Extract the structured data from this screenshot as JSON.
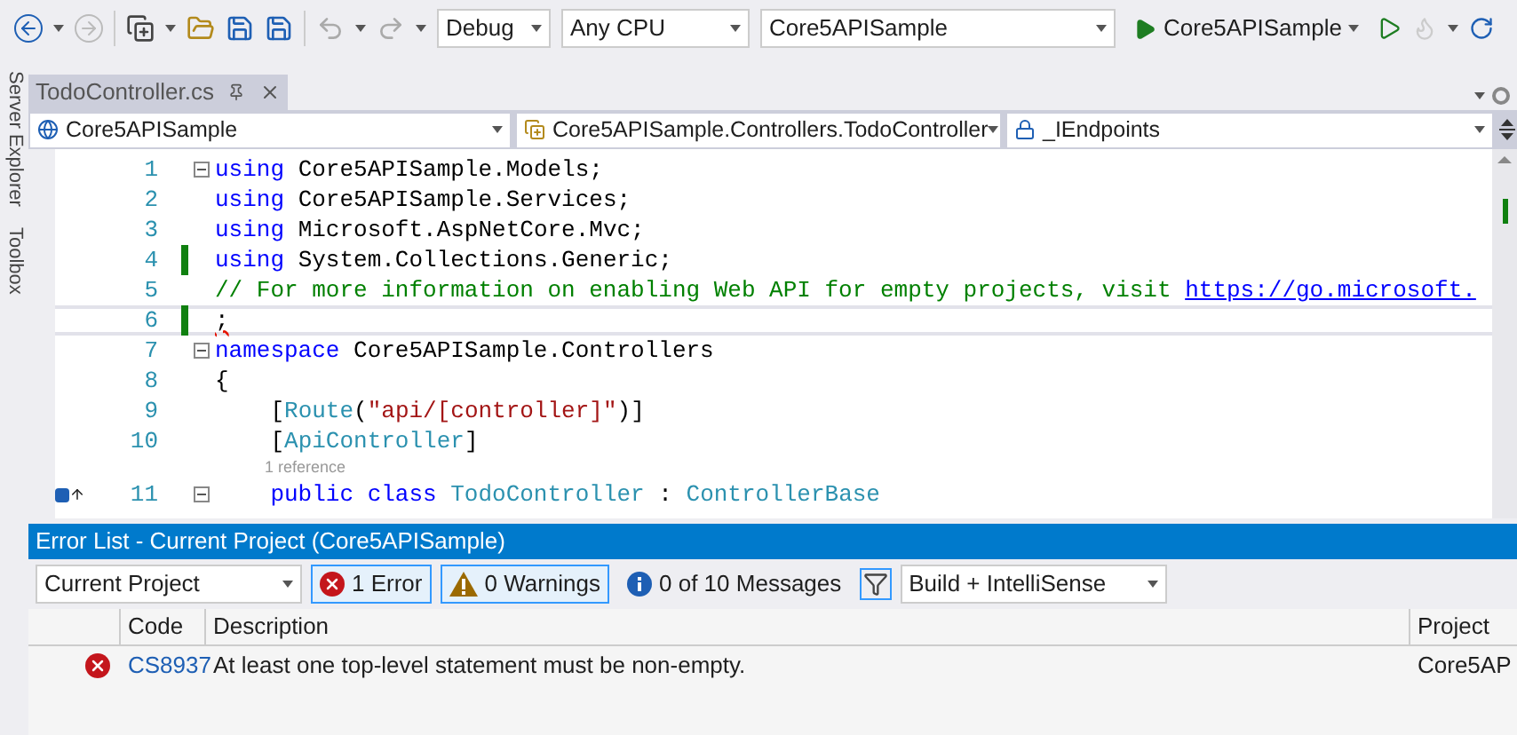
{
  "toolbar": {
    "configuration": "Debug",
    "platform": "Any CPU",
    "startup_project": "Core5APISample",
    "run_label": "Core5APISample"
  },
  "side_tabs": [
    "Server Explorer",
    "Toolbox"
  ],
  "document_tabs": [
    {
      "title": "TodoController.cs",
      "selected": true
    }
  ],
  "nav_bar": [
    "Core5APISample",
    "Core5APISample.Controllers.TodoController",
    "_IEndpoints"
  ],
  "editor": {
    "lines": [
      {
        "number": "1",
        "fold": true,
        "changed": false,
        "current": false,
        "tokens": [
          {
            "kind": "keyword",
            "text": "using"
          },
          {
            "kind": "plain",
            "text": " Core5APISample.Models;"
          }
        ]
      },
      {
        "number": "2",
        "fold": false,
        "changed": false,
        "current": false,
        "tokens": [
          {
            "kind": "keyword",
            "text": "using"
          },
          {
            "kind": "plain",
            "text": " Core5APISample.Services;"
          }
        ]
      },
      {
        "number": "3",
        "fold": false,
        "changed": false,
        "current": false,
        "tokens": [
          {
            "kind": "keyword",
            "text": "using"
          },
          {
            "kind": "plain",
            "text": " Microsoft.AspNetCore.Mvc;"
          }
        ]
      },
      {
        "number": "4",
        "fold": false,
        "changed": true,
        "current": false,
        "tokens": [
          {
            "kind": "keyword",
            "text": "using"
          },
          {
            "kind": "plain",
            "text": " System.Collections.Generic;"
          }
        ]
      },
      {
        "number": "5",
        "fold": false,
        "changed": false,
        "current": false,
        "tokens": [
          {
            "kind": "comment",
            "text": "// For more information on enabling Web API for empty projects, visit "
          },
          {
            "kind": "link",
            "text": "https://go.microsoft."
          }
        ]
      },
      {
        "number": "6",
        "fold": false,
        "changed": true,
        "current": true,
        "tokens": [
          {
            "kind": "error",
            "text": ";"
          }
        ]
      },
      {
        "number": "7",
        "fold": true,
        "changed": false,
        "current": false,
        "tokens": [
          {
            "kind": "keyword",
            "text": "namespace"
          },
          {
            "kind": "plain",
            "text": " Core5APISample.Controllers"
          }
        ]
      },
      {
        "number": "8",
        "fold": false,
        "changed": false,
        "current": false,
        "tokens": [
          {
            "kind": "plain",
            "text": "{"
          }
        ]
      },
      {
        "number": "9",
        "fold": false,
        "changed": false,
        "current": false,
        "tokens": [
          {
            "kind": "plain",
            "text": "    ["
          },
          {
            "kind": "type",
            "text": "Route"
          },
          {
            "kind": "plain",
            "text": "("
          },
          {
            "kind": "string",
            "text": "\"api/[controller]\""
          },
          {
            "kind": "plain",
            "text": ")]"
          }
        ]
      },
      {
        "number": "10",
        "fold": false,
        "changed": false,
        "current": false,
        "tokens": [
          {
            "kind": "plain",
            "text": "    ["
          },
          {
            "kind": "type",
            "text": "ApiController"
          },
          {
            "kind": "plain",
            "text": "]"
          }
        ]
      },
      {
        "number": "11",
        "fold": true,
        "changed": false,
        "current": false,
        "codelens": "1 reference",
        "tokens": [
          {
            "kind": "keyword",
            "text": "    public class"
          },
          {
            "kind": "type",
            "text": " TodoController"
          },
          {
            "kind": "plain",
            "text": " : "
          },
          {
            "kind": "type",
            "text": "ControllerBase"
          }
        ]
      }
    ]
  },
  "error_list": {
    "title": "Error List - Current Project (Core5APISample)",
    "scope": "Current Project",
    "filters": [
      {
        "kind": "error",
        "label": "1 Error",
        "selected": true
      },
      {
        "kind": "warning",
        "label": "0 Warnings",
        "selected": true
      },
      {
        "kind": "message",
        "label": "0 of 10 Messages",
        "selected": false
      }
    ],
    "build_filter": "Build + IntelliSense",
    "columns": [
      "Code",
      "Description",
      "Project"
    ],
    "rows": [
      {
        "kind": "error",
        "code": "CS8937",
        "description": "At least one top-level statement must be non-empty.",
        "project": "Core5AP"
      }
    ]
  }
}
